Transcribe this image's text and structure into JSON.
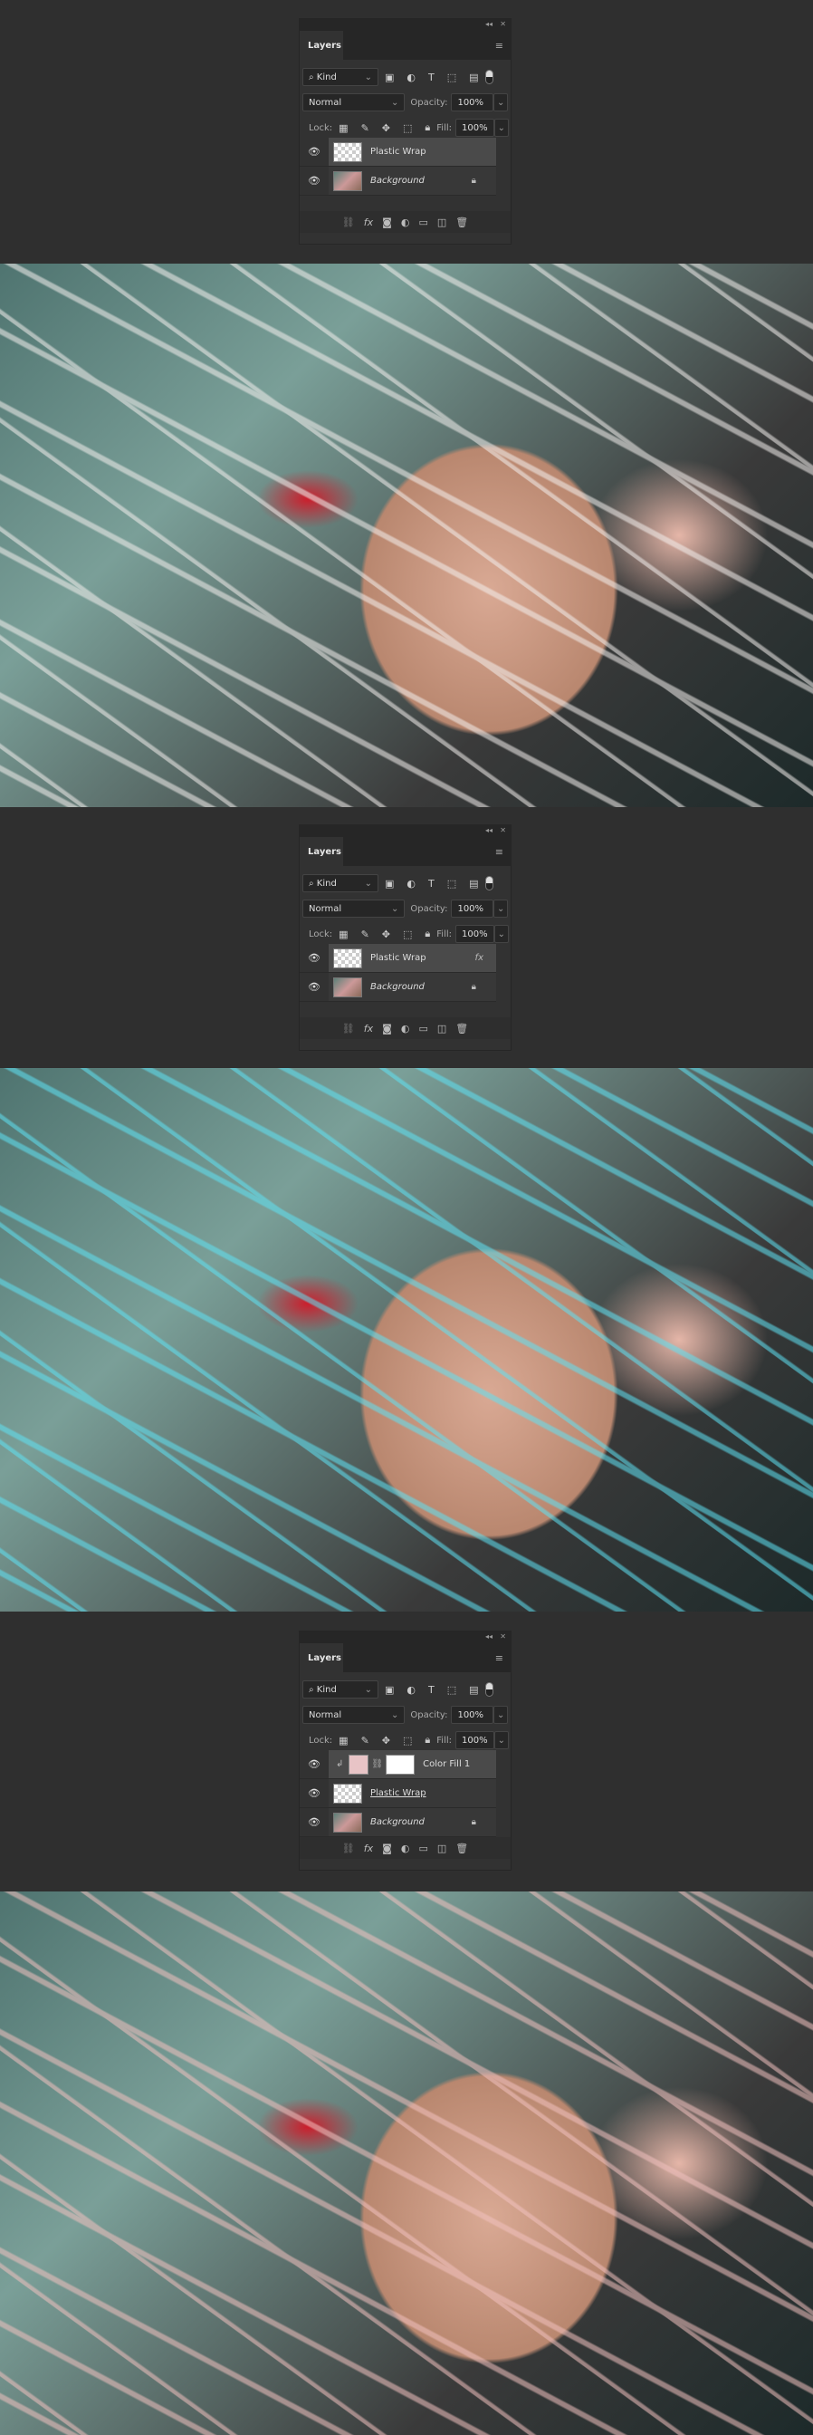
{
  "panels": [
    {
      "tab": "Layers",
      "kind": "Kind",
      "blend": "Normal",
      "opacity_label": "Opacity:",
      "opacity": "100%",
      "lock_label": "Lock:",
      "fill_label": "Fill:",
      "fill": "100%",
      "layers": [
        {
          "name": "Plastic Wrap",
          "selected": true,
          "type": "transparent"
        },
        {
          "name": "Background",
          "italic": true,
          "locked": true,
          "type": "image"
        }
      ]
    },
    {
      "tab": "Layers",
      "kind": "Kind",
      "blend": "Normal",
      "opacity_label": "Opacity:",
      "opacity": "100%",
      "lock_label": "Lock:",
      "fill_label": "Fill:",
      "fill": "100%",
      "layers": [
        {
          "name": "Plastic Wrap",
          "selected": true,
          "type": "transparent",
          "fx": "fx"
        },
        {
          "name": "Background",
          "italic": true,
          "locked": true,
          "type": "image"
        }
      ]
    },
    {
      "tab": "Layers",
      "kind": "Kind",
      "blend": "Normal",
      "opacity_label": "Opacity:",
      "opacity": "100%",
      "lock_label": "Lock:",
      "fill_label": "Fill:",
      "fill": "100%",
      "layers": [
        {
          "name": "Color Fill 1",
          "selected": true,
          "type": "fill",
          "fill_color": "#e8c4c6",
          "clipped": true
        },
        {
          "name": "Plastic Wrap",
          "type": "transparent",
          "underline": true
        },
        {
          "name": "Background",
          "italic": true,
          "locked": true,
          "type": "image"
        }
      ]
    }
  ],
  "photos": [
    {
      "streak_color": "#f4f0ee"
    },
    {
      "streak_color": "#5fe3f5"
    },
    {
      "streak_color": "#f2c2c0"
    }
  ]
}
